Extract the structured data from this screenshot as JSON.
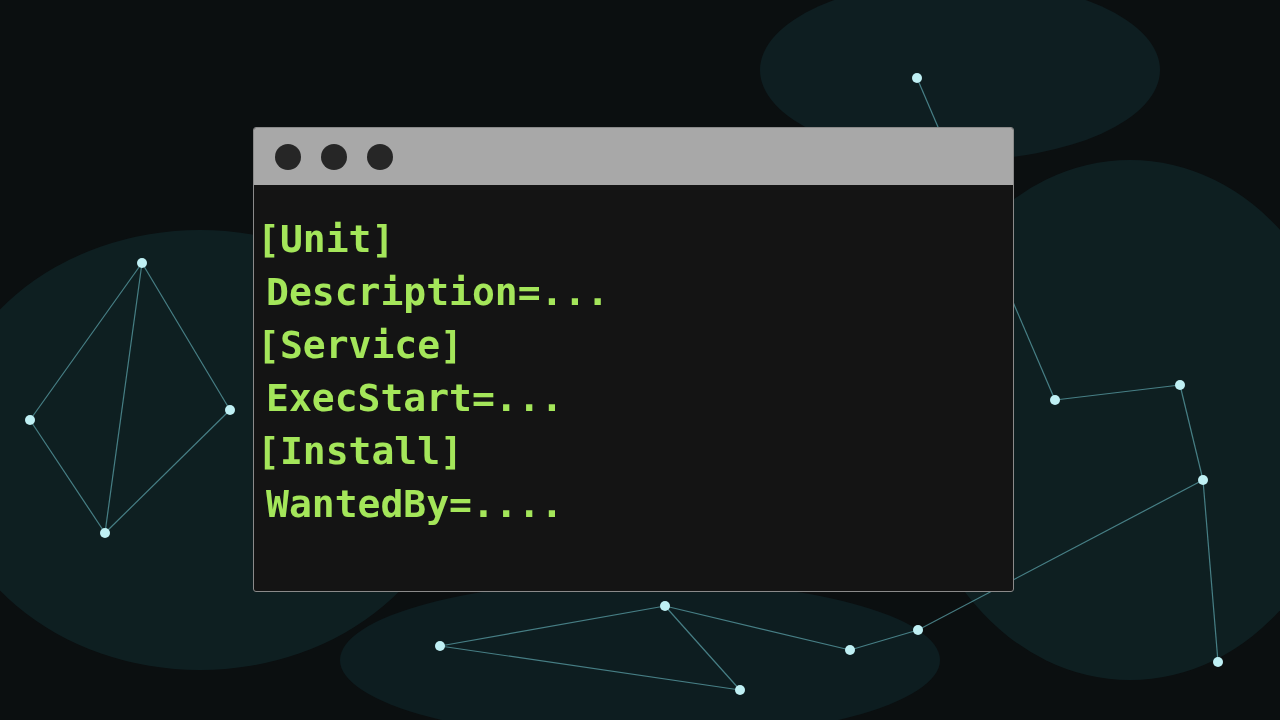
{
  "terminal": {
    "lines": [
      {
        "kind": "section",
        "text": "[Unit]"
      },
      {
        "kind": "key",
        "text": "Description=..."
      },
      {
        "kind": "section",
        "text": "[Service]"
      },
      {
        "kind": "key",
        "text": "ExecStart=..."
      },
      {
        "kind": "section",
        "text": "[Install]"
      },
      {
        "kind": "key",
        "text": "WantedBy=...."
      }
    ]
  }
}
